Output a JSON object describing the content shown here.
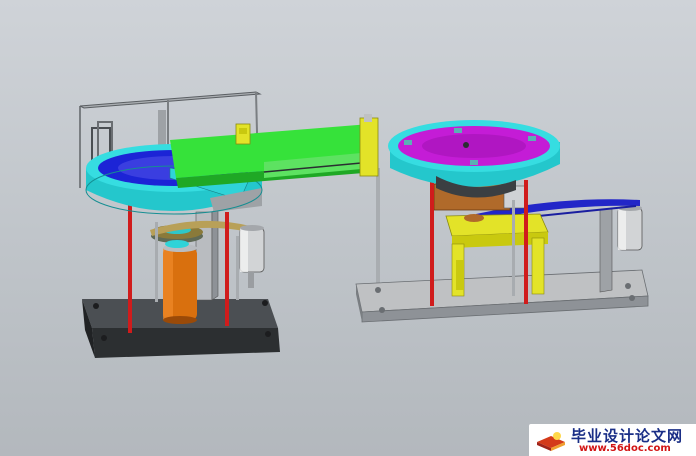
{
  "scene": {
    "subject": "3D CAD assembly model of a dual rotary-disc feeding mechanism",
    "background_color": "#c6cacf"
  },
  "colors": {
    "base_dark": "#3a3d40",
    "base_light": "#bfc1c3",
    "disc_cyan": "#2fd3d8",
    "disc_inner_blue": "#1418d8",
    "disc_magenta": "#c41cd6",
    "rail_green": "#36e23a",
    "bracket_yellow": "#e3e328",
    "column_orange": "#d9700e",
    "rod_red": "#d01c1c",
    "gear_bronze": "#b06a2a"
  },
  "watermark": {
    "title": "毕业设计论文网",
    "url": "www.56doc.com",
    "logo_icon": "book-logo-icon"
  }
}
